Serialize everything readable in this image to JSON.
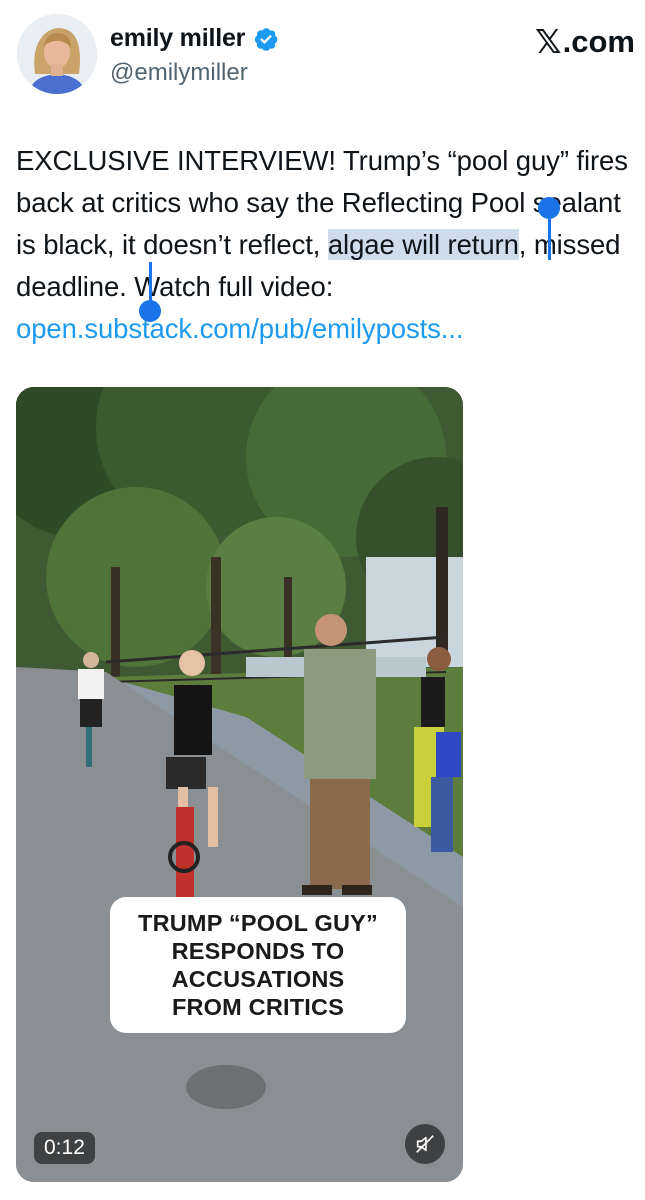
{
  "author": {
    "name": "emily miller",
    "handle": "@emilymiller",
    "verified": true,
    "avatar_icon": "profile-photo"
  },
  "source": {
    "x_mark": "𝕏",
    "label": ".com"
  },
  "post": {
    "text_before_selection_1": "EXCLUSIVE INTERVIEW! Trump’s “pool guy” fires back at critics who say the Reflecting Pool sealant is black, it doesn’t reflect, ",
    "selected_1": "algae",
    "line_break_space": " ",
    "selected_2": "will return",
    "text_after_selection": ", missed deadline. Watch full video: ",
    "link": "open.substack.com/pub/emilyposts..."
  },
  "media": {
    "caption_lines": [
      "TRUMP “POOL GUY”",
      "RESPONDS TO",
      "ACCUSATIONS",
      "FROM CRITICS"
    ],
    "duration": "0:12",
    "mute_icon": "speaker-muted-icon"
  },
  "colors": {
    "link": "#1d9bf0",
    "selection": "#cfdcec",
    "selection_handle": "#1a73e8",
    "verified": "#1d9bf0"
  }
}
